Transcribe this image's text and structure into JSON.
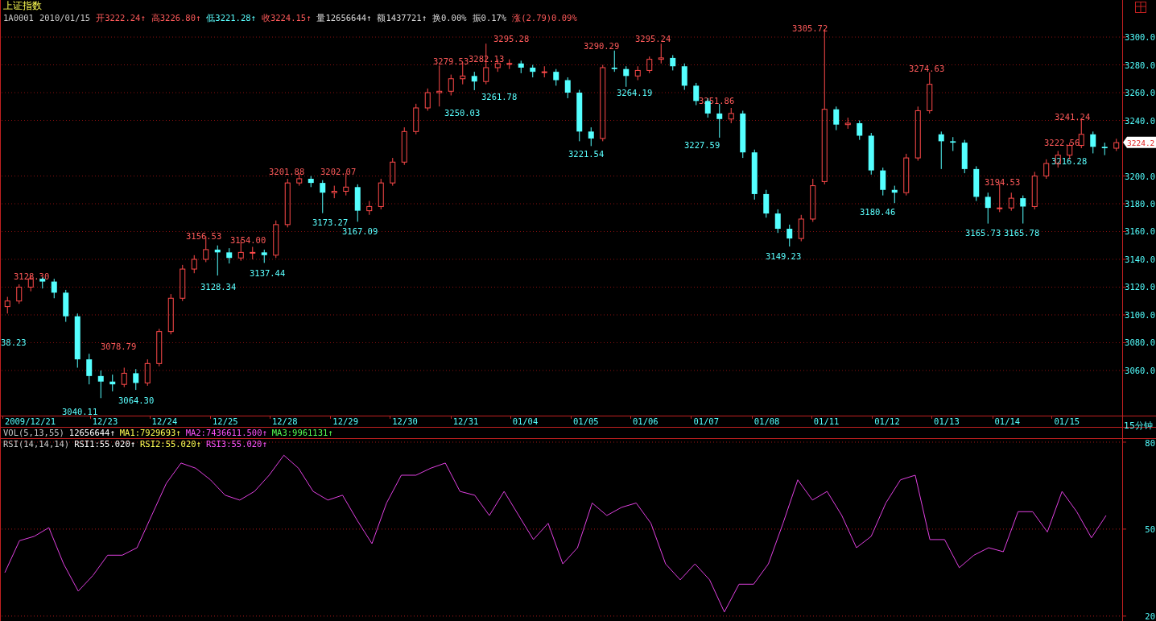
{
  "title": "上证指数",
  "quote": [
    {
      "text": "1A0001",
      "color": "#c8c8c8"
    },
    {
      "text": "2010/01/15",
      "color": "#c8c8c8"
    },
    {
      "text": "开3222.24↑",
      "color": "#ff5a5a"
    },
    {
      "text": "高3226.80↑",
      "color": "#ff5a5a"
    },
    {
      "text": "低3221.28↑",
      "color": "#5affff"
    },
    {
      "text": "收3224.15↑",
      "color": "#ff5a5a"
    },
    {
      "text": "量12656644↑",
      "color": "#d8d8d8"
    },
    {
      "text": "额1437721↑",
      "color": "#d8d8d8"
    },
    {
      "text": "换0.00%",
      "color": "#d8d8d8"
    },
    {
      "text": "振0.17%",
      "color": "#d8d8d8"
    },
    {
      "text": "涨(2.79)0.09%",
      "color": "#ff5a5a"
    }
  ],
  "price_chart": {
    "chart_data": {
      "type": "candlestick",
      "ylim": [
        3027.5,
        3309.3
      ],
      "yticks": [
        {
          "value": 3300,
          "label": "3300.0"
        },
        {
          "value": 3280,
          "label": "3280.0"
        },
        {
          "value": 3260,
          "label": "3260.0"
        },
        {
          "value": 3240,
          "label": "3240.0"
        },
        {
          "value": 3200,
          "label": "3200.0"
        },
        {
          "value": 3180,
          "label": "3180.0"
        },
        {
          "value": 3160,
          "label": "3160.0"
        },
        {
          "value": 3140,
          "label": "3140.0"
        },
        {
          "value": 3120,
          "label": "3120.0"
        },
        {
          "value": 3100,
          "label": "3100.0"
        },
        {
          "value": 3080,
          "label": "3080.0"
        },
        {
          "value": 3060,
          "label": "3060.0"
        }
      ],
      "grid": true,
      "ohlc": [
        [
          3106,
          3113,
          3101,
          3110
        ],
        [
          3110,
          3122,
          3108,
          3120
        ],
        [
          3120,
          3128.3,
          3117,
          3126
        ],
        [
          3126,
          3127,
          3119,
          3124
        ],
        [
          3124,
          3126,
          3112,
          3116
        ],
        [
          3116,
          3118,
          3095,
          3099
        ],
        [
          3099,
          3101,
          3062,
          3068
        ],
        [
          3068,
          3072,
          3050,
          3056
        ],
        [
          3056,
          3060,
          3040.11,
          3052
        ],
        [
          3052,
          3057,
          3045,
          3050
        ],
        [
          3050,
          3062,
          3048,
          3058
        ],
        [
          3058,
          3061,
          3046,
          3051
        ],
        [
          3051,
          3068,
          3049,
          3065
        ],
        [
          3065,
          3090,
          3063,
          3088
        ],
        [
          3088,
          3115,
          3086,
          3112
        ],
        [
          3112,
          3136,
          3110,
          3133
        ],
        [
          3133,
          3143,
          3130,
          3140
        ],
        [
          3140,
          3156.53,
          3138,
          3147
        ],
        [
          3147,
          3150,
          3128.34,
          3145
        ],
        [
          3145,
          3148,
          3137,
          3141
        ],
        [
          3141,
          3154,
          3139,
          3145
        ],
        [
          3145,
          3149,
          3140,
          3145
        ],
        [
          3145,
          3147,
          3137.44,
          3143
        ],
        [
          3143,
          3168,
          3141,
          3165
        ],
        [
          3165,
          3198,
          3163,
          3195
        ],
        [
          3195,
          3201.88,
          3193,
          3198
        ],
        [
          3198,
          3200,
          3192,
          3195
        ],
        [
          3195,
          3197,
          3173.27,
          3188
        ],
        [
          3188,
          3193,
          3184,
          3189
        ],
        [
          3189,
          3202.07,
          3186,
          3192
        ],
        [
          3192,
          3194,
          3167.09,
          3175
        ],
        [
          3175,
          3182,
          3172,
          3178
        ],
        [
          3178,
          3198,
          3176,
          3195
        ],
        [
          3195,
          3213,
          3193,
          3210
        ],
        [
          3210,
          3235,
          3208,
          3232
        ],
        [
          3232,
          3252,
          3230,
          3249
        ],
        [
          3249,
          3263,
          3247,
          3260
        ],
        [
          3260,
          3279.53,
          3250.03,
          3261
        ],
        [
          3261,
          3273,
          3258,
          3270
        ],
        [
          3270,
          3282.13,
          3266,
          3272
        ],
        [
          3272,
          3275,
          3261.78,
          3268
        ],
        [
          3268,
          3295.28,
          3266,
          3278
        ],
        [
          3278,
          3284,
          3275,
          3281
        ],
        [
          3281,
          3284,
          3277,
          3281
        ],
        [
          3281,
          3283,
          3274,
          3278
        ],
        [
          3278,
          3280,
          3271,
          3275
        ],
        [
          3275,
          3279,
          3271,
          3275
        ],
        [
          3275,
          3277,
          3265,
          3269
        ],
        [
          3269,
          3271,
          3256,
          3260
        ],
        [
          3260,
          3262,
          3225,
          3232
        ],
        [
          3232,
          3235,
          3221.54,
          3227
        ],
        [
          3227,
          3280,
          3225,
          3278
        ],
        [
          3278,
          3290.29,
          3275,
          3277
        ],
        [
          3277,
          3279,
          3264.19,
          3272
        ],
        [
          3272,
          3279,
          3269,
          3276
        ],
        [
          3276,
          3286,
          3274,
          3284
        ],
        [
          3284,
          3295.24,
          3281,
          3285
        ],
        [
          3285,
          3287,
          3276,
          3279
        ],
        [
          3279,
          3281,
          3262,
          3265
        ],
        [
          3265,
          3267,
          3251,
          3254
        ],
        [
          3254,
          3256,
          3242,
          3245
        ],
        [
          3245,
          3251.86,
          3227.59,
          3241
        ],
        [
          3241,
          3249,
          3238,
          3245
        ],
        [
          3245,
          3247,
          3213,
          3217
        ],
        [
          3217,
          3219,
          3183,
          3187
        ],
        [
          3187,
          3190,
          3170,
          3173
        ],
        [
          3173,
          3176,
          3159,
          3162
        ],
        [
          3162,
          3165,
          3149.23,
          3155
        ],
        [
          3155,
          3172,
          3153,
          3169
        ],
        [
          3169,
          3198,
          3167,
          3193
        ],
        [
          3196,
          3305.72,
          3194,
          3248
        ],
        [
          3248,
          3250,
          3233,
          3237
        ],
        [
          3237,
          3242,
          3234,
          3238
        ],
        [
          3238,
          3240,
          3226,
          3229
        ],
        [
          3229,
          3231,
          3201,
          3204
        ],
        [
          3204,
          3206,
          3186,
          3190
        ],
        [
          3190,
          3193,
          3180.46,
          3188
        ],
        [
          3188,
          3216,
          3186,
          3213
        ],
        [
          3213,
          3250,
          3211,
          3247
        ],
        [
          3247,
          3274.63,
          3245,
          3266
        ],
        [
          3230,
          3232,
          3205,
          3225
        ],
        [
          3225,
          3228,
          3218,
          3224
        ],
        [
          3224,
          3226,
          3202,
          3205
        ],
        [
          3205,
          3207,
          3182,
          3185
        ],
        [
          3185,
          3188,
          3165.73,
          3177
        ],
        [
          3177,
          3194.53,
          3174,
          3177
        ],
        [
          3177,
          3188,
          3175,
          3184
        ],
        [
          3184,
          3186,
          3165.78,
          3178
        ],
        [
          3178,
          3203,
          3176,
          3200
        ],
        [
          3200,
          3212,
          3198,
          3209
        ],
        [
          3209,
          3218,
          3206,
          3215
        ],
        [
          3215,
          3224,
          3212,
          3222
        ],
        [
          3222,
          3241.24,
          3220,
          3230
        ],
        [
          3230,
          3232,
          3216.28,
          3221
        ],
        [
          3221,
          3224,
          3215,
          3220
        ],
        [
          3220,
          3226.8,
          3218,
          3224
        ]
      ]
    }
  },
  "dates": [
    "2009/12/21",
    "12/23",
    "12/24",
    "12/25",
    "12/28",
    "12/29",
    "12/30",
    "12/31",
    "01/04",
    "01/05",
    "01/06",
    "01/07",
    "01/08",
    "01/11",
    "01/12",
    "01/13",
    "01/14",
    "01/15"
  ],
  "last_price": "3224.2",
  "price_labels": [
    {
      "text": "3128.30",
      "kind": "high"
    },
    {
      "text": "38.23",
      "kind": "low"
    },
    {
      "text": "3078.79",
      "kind": "high"
    },
    {
      "text": "3064.30",
      "kind": "low"
    },
    {
      "text": "3040.11",
      "kind": "low"
    },
    {
      "text": "3156.53",
      "kind": "high"
    },
    {
      "text": "3154.00",
      "kind": "high"
    },
    {
      "text": "3128.34",
      "kind": "low"
    },
    {
      "text": "3137.44",
      "kind": "low"
    },
    {
      "text": "3201.88",
      "kind": "high"
    },
    {
      "text": "3202.07",
      "kind": "high"
    },
    {
      "text": "3173.27",
      "kind": "low"
    },
    {
      "text": "3167.09",
      "kind": "low"
    },
    {
      "text": "3279.53",
      "kind": "high"
    },
    {
      "text": "3282.13",
      "kind": "high"
    },
    {
      "text": "3295.28",
      "kind": "high"
    },
    {
      "text": "3250.03",
      "kind": "low"
    },
    {
      "text": "3261.78",
      "kind": "low"
    },
    {
      "text": "3290.29",
      "kind": "high"
    },
    {
      "text": "3295.24",
      "kind": "high"
    },
    {
      "text": "3264.19",
      "kind": "low"
    },
    {
      "text": "3221.54",
      "kind": "low"
    },
    {
      "text": "3251.86",
      "kind": "high"
    },
    {
      "text": "3227.59",
      "kind": "low"
    },
    {
      "text": "3305.72",
      "kind": "high"
    },
    {
      "text": "3149.23",
      "kind": "low"
    },
    {
      "text": "3180.46",
      "kind": "low"
    },
    {
      "text": "3274.63",
      "kind": "high"
    },
    {
      "text": "3241.24",
      "kind": "high"
    },
    {
      "text": "3222.56",
      "kind": "high"
    },
    {
      "text": "3216.28",
      "kind": "low"
    },
    {
      "text": "3194.53",
      "kind": "high"
    },
    {
      "text": "3165.73",
      "kind": "low"
    },
    {
      "text": "3165.78",
      "kind": "low"
    }
  ],
  "period": "15分钟",
  "vol_legend": [
    {
      "text": "VOL(5,13,55)",
      "color": "#c8c8c8"
    },
    {
      "text": "12656644↑",
      "color": "#ffffff"
    },
    {
      "text": "MA1:7929693↑",
      "color": "#ffff54"
    },
    {
      "text": "MA2:7436611.500↑",
      "color": "#ff54ff"
    },
    {
      "text": "MA3:9961131↑",
      "color": "#54ff54"
    }
  ],
  "rsi_legend": [
    {
      "text": "RSI(14,14,14)",
      "color": "#c8c8c8"
    },
    {
      "text": "RSI1:55.020↑",
      "color": "#ffffff"
    },
    {
      "text": "RSI2:55.020↑",
      "color": "#ffff54"
    },
    {
      "text": "RSI3:55.020↑",
      "color": "#ff54ff"
    }
  ],
  "rsi": {
    "chart_data": {
      "type": "line",
      "ylim": [
        18.3,
        81.1
      ],
      "yticks": [
        80,
        50,
        20
      ],
      "grid": true,
      "series": [
        {
          "color": "#e040e0",
          "values": [
            35,
            46,
            47.5,
            50.5,
            38,
            28.6,
            34,
            41,
            41,
            43.6,
            54.7,
            65.8,
            72.8,
            71,
            67,
            61.7,
            60,
            63,
            68.6,
            75.5,
            71,
            63,
            60,
            61.7,
            53,
            45,
            59,
            68.6,
            68.6,
            71,
            72.8,
            63,
            61.7,
            54.7,
            63,
            54.7,
            46.4,
            52,
            38,
            43.6,
            59,
            54.7,
            57.5,
            59,
            52,
            38,
            32.5,
            38,
            32.5,
            21.4,
            31,
            31,
            38,
            52,
            67,
            60,
            63,
            54.7,
            43.6,
            47.5,
            59,
            67,
            68.6,
            46.4,
            46.4,
            36.7,
            41,
            43.6,
            42.2,
            56,
            56,
            49,
            63,
            56,
            47,
            54.7
          ]
        }
      ]
    }
  }
}
